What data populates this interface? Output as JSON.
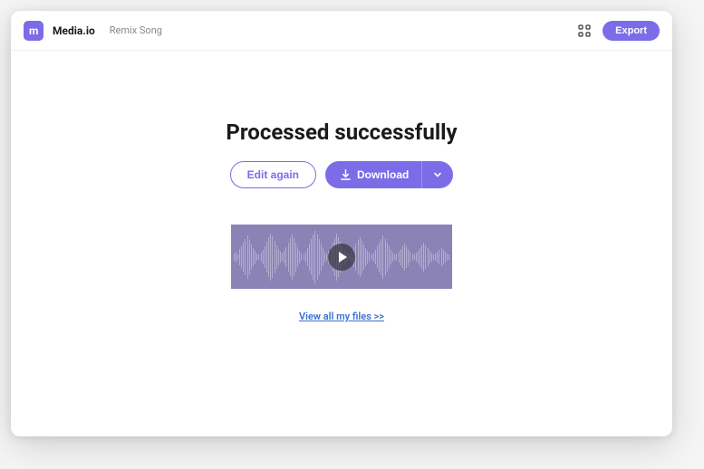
{
  "header": {
    "logo_text": "m",
    "brand_name": "Media.io",
    "page_name": "Remix Song",
    "export_label": "Export"
  },
  "main": {
    "title": "Processed successfully",
    "edit_label": "Edit again",
    "download_label": "Download",
    "view_files_label": "View all my files >>"
  },
  "colors": {
    "accent": "#7c6ce8",
    "link": "#3a6fd8"
  }
}
